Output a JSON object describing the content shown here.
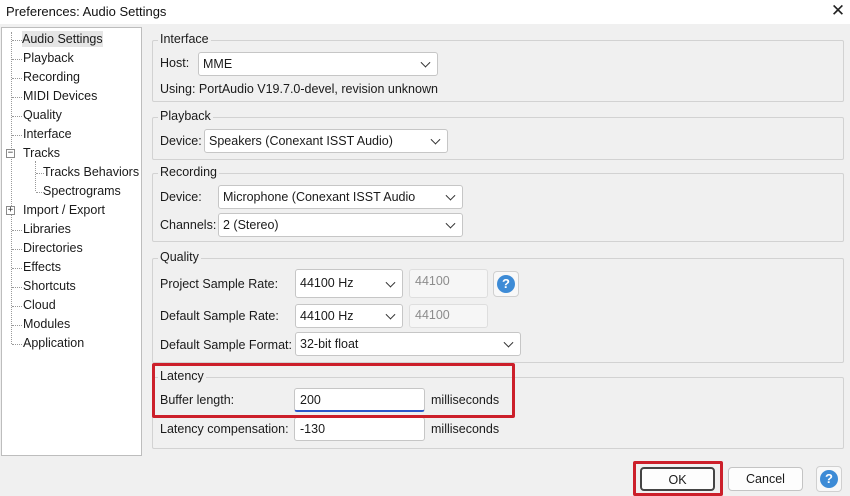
{
  "window": {
    "title": "Preferences: Audio Settings"
  },
  "tree": {
    "items": [
      "Audio Settings",
      "Playback",
      "Recording",
      "MIDI Devices",
      "Quality",
      "Interface",
      "Tracks",
      "Tracks Behaviors",
      "Spectrograms",
      "Import / Export",
      "Libraries",
      "Directories",
      "Effects",
      "Shortcuts",
      "Cloud",
      "Modules",
      "Application"
    ],
    "expand_minus": "−",
    "expand_plus": "+"
  },
  "interface": {
    "title": "Interface",
    "host_label": "Host:",
    "host_value": "MME",
    "using_text": "Using: PortAudio V19.7.0-devel, revision unknown"
  },
  "playback": {
    "title": "Playback",
    "device_label": "Device:",
    "device_value": "Speakers (Conexant ISST Audio)"
  },
  "recording": {
    "title": "Recording",
    "device_label": "Device:",
    "device_value": "Microphone (Conexant ISST Audio",
    "channels_label": "Channels:",
    "channels_value": "2 (Stereo)"
  },
  "quality": {
    "title": "Quality",
    "project_rate_label": "Project Sample Rate:",
    "project_rate_value": "44100 Hz",
    "project_rate_text": "44100",
    "default_rate_label": "Default Sample Rate:",
    "default_rate_value": "44100 Hz",
    "default_rate_text": "44100",
    "format_label": "Default Sample Format:",
    "format_value": "32-bit float",
    "help": "?"
  },
  "latency": {
    "title": "Latency",
    "buffer_label": "Buffer length:",
    "buffer_value": "200",
    "buffer_unit": "milliseconds",
    "comp_label": "Latency compensation:",
    "comp_value": "-130",
    "comp_unit": "milliseconds"
  },
  "buttons": {
    "ok": "OK",
    "cancel": "Cancel",
    "help": "?"
  },
  "colors": {
    "highlight": "#cc1f2a",
    "help_blue": "#3d8bd6",
    "focus_underline": "#2c56c9"
  }
}
